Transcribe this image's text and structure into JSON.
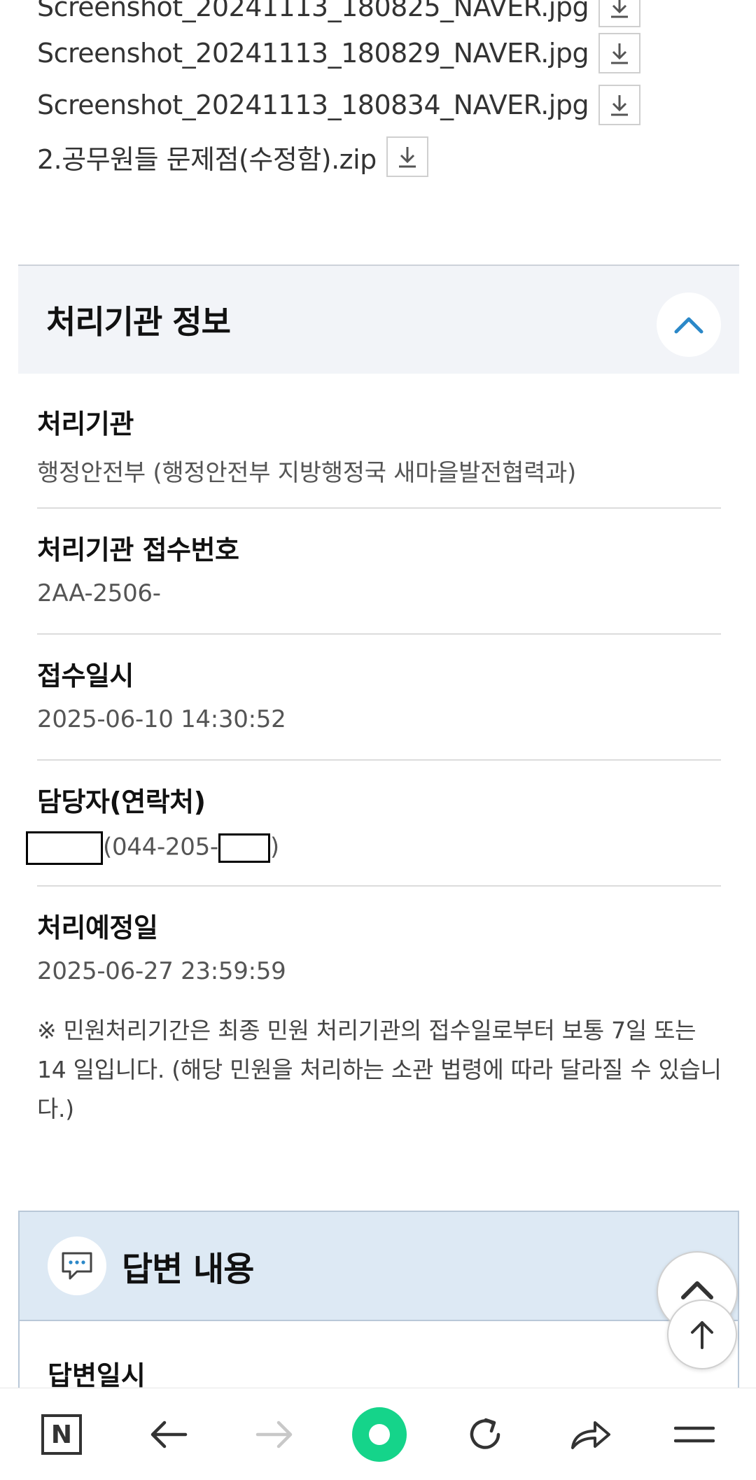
{
  "attachments": {
    "files": [
      {
        "name": "Screenshot_20241113_180825_NAVER.jpg"
      },
      {
        "name": "Screenshot_20241113_180829_NAVER.jpg"
      },
      {
        "name": "Screenshot_20241113_180834_NAVER.jpg"
      },
      {
        "name": "2.공무원들 문제점(수정함).zip"
      }
    ]
  },
  "agency_section": {
    "title": "처리기관 정보",
    "items": [
      {
        "label": "처리기관",
        "value": "행정안전부 (행정안전부 지방행정국 새마을발전협력과)"
      },
      {
        "label": "처리기관 접수번호",
        "value": "2AA-2506-"
      },
      {
        "label": "접수일시",
        "value": "2025-06-10 14:30:52"
      },
      {
        "label": "담당자(연락처)",
        "value_open": "(044-205-",
        "value_close": ")"
      },
      {
        "label": "처리예정일",
        "value": "2025-06-27 23:59:59"
      }
    ],
    "notice": "※ 민원처리기간은 최종 민원 처리기관의 접수일로부터 보통 7일 또는 14 일입니다. (해당 민원을 처리하는 소관 법령에 따라 달라질 수 있습니다.)"
  },
  "answer_section": {
    "title": "답변 내용",
    "first_label": "답변일시"
  },
  "bottom_nav": {
    "naver_letter": "N"
  },
  "colors": {
    "accent_blue": "#2b88c8",
    "green_button": "#15d48a",
    "section_bg": "#f2f4f8",
    "answer_bg": "#dde9f4"
  }
}
